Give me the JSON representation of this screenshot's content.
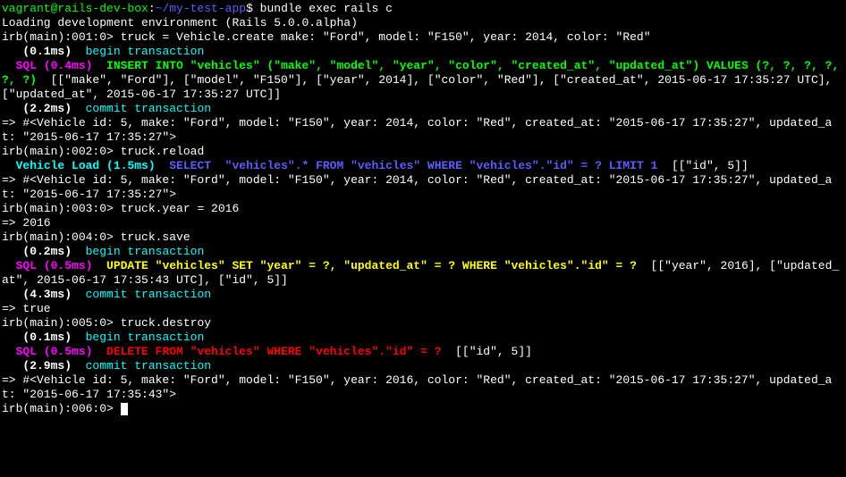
{
  "shell": {
    "prompt_user": "vagrant@rails-dev-box",
    "prompt_path": "~/my-test-app",
    "command": "bundle exec rails c"
  },
  "rails": {
    "loading_msg": "Loading development environment (Rails 5.0.0.alpha)"
  },
  "irb": {
    "prompts": [
      "irb(main):001:0> ",
      "irb(main):002:0> ",
      "irb(main):003:0> ",
      "irb(main):004:0> ",
      "irb(main):005:0> ",
      "irb(main):006:0> "
    ],
    "commands": [
      "truck = Vehicle.create make: \"Ford\", model: \"F150\", year: 2014, color: \"Red\"",
      "truck.reload",
      "truck.year = 2016",
      "truck.save",
      "truck.destroy"
    ]
  },
  "transactions": [
    {
      "begin_time": "(0.1ms)  ",
      "begin_text": "begin transaction",
      "commit_time": "(2.2ms)  ",
      "commit_text": "commit transaction"
    },
    {
      "begin_time": "(0.2ms)  ",
      "begin_text": "begin transaction",
      "commit_time": "(4.3ms)  ",
      "commit_text": "commit transaction"
    },
    {
      "begin_time": "(0.1ms)  ",
      "begin_text": "begin transaction",
      "commit_time": "(2.9ms)  ",
      "commit_text": "commit transaction"
    }
  ],
  "sql": {
    "insert": {
      "label": "  SQL (0.4ms)  ",
      "stmt": "INSERT INTO \"vehicles\" (\"make\", \"model\", \"year\", \"color\", \"created_at\", \"updated_at\") VALUES (?, ?, ?, ?, ?, ?)",
      "params": "  [[\"make\", \"Ford\"], [\"model\", \"F150\"], [\"year\", 2014], [\"color\", \"Red\"], [\"created_at\", 2015-06-17 17:35:27 UTC], [\"updated_at\", 2015-06-17 17:35:27 UTC]]"
    },
    "load": {
      "label": "  Vehicle Load (1.5ms)  ",
      "stmt": "SELECT  \"vehicles\".* FROM \"vehicles\" WHERE \"vehicles\".\"id\" = ? LIMIT 1",
      "params": "  [[\"id\", 5]]"
    },
    "update": {
      "label": "  SQL (0.5ms)  ",
      "stmt": "UPDATE \"vehicles\" SET \"year\" = ?, \"updated_at\" = ? WHERE \"vehicles\".\"id\" = ?",
      "params": "  [[\"year\", 2016], [\"updated_at\", 2015-06-17 17:35:43 UTC], [\"id\", 5]]"
    },
    "delete": {
      "label": "  SQL (0.5ms)  ",
      "stmt": "DELETE FROM \"vehicles\" WHERE \"vehicles\".\"id\" = ?",
      "params": "  [[\"id\", 5]]"
    }
  },
  "results": [
    "=> #<Vehicle id: 5, make: \"Ford\", model: \"F150\", year: 2014, color: \"Red\", created_at: \"2015-06-17 17:35:27\", updated_at: \"2015-06-17 17:35:27\">",
    "=> #<Vehicle id: 5, make: \"Ford\", model: \"F150\", year: 2014, color: \"Red\", created_at: \"2015-06-17 17:35:27\", updated_at: \"2015-06-17 17:35:27\">",
    "=> 2016",
    "=> true",
    "=> #<Vehicle id: 5, make: \"Ford\", model: \"F150\", year: 2016, color: \"Red\", created_at: \"2015-06-17 17:35:27\", updated_at: \"2015-06-17 17:35:43\">"
  ]
}
